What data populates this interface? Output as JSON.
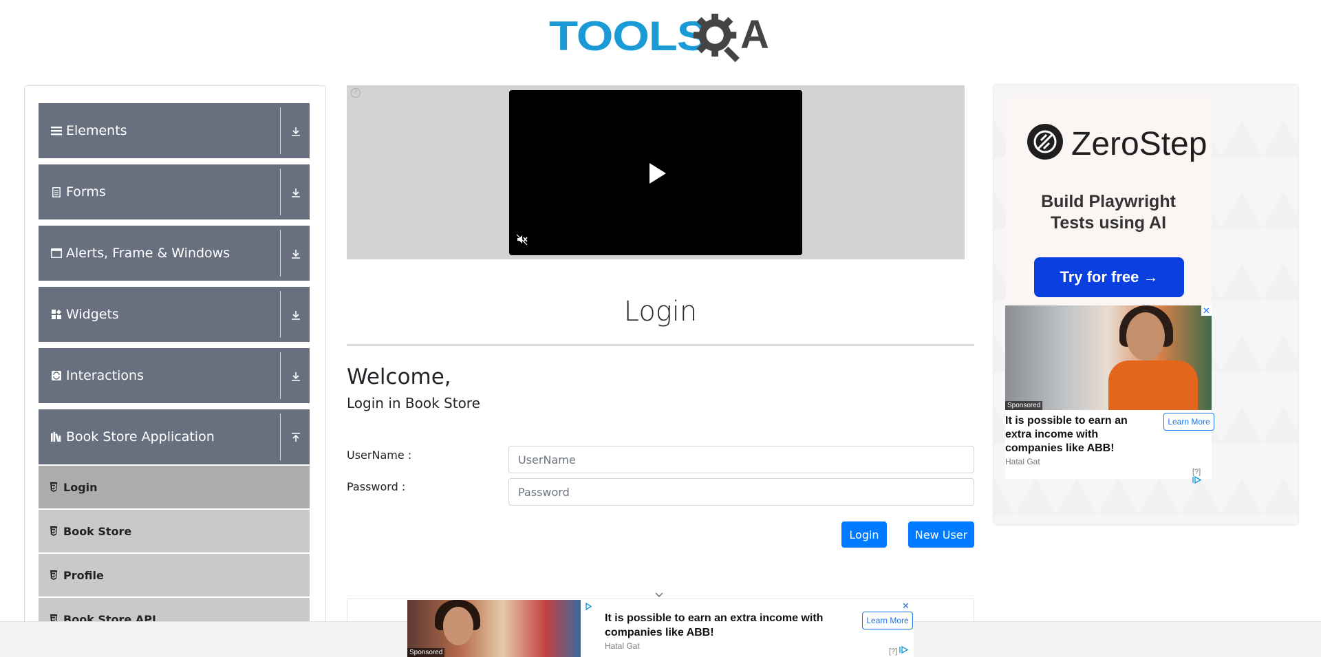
{
  "logo": {
    "text_tools": "TOOLS",
    "text_a": "A"
  },
  "sidebar": {
    "groups": [
      {
        "label": "Elements",
        "icon": "list-icon"
      },
      {
        "label": "Forms",
        "icon": "document-icon"
      },
      {
        "label": "Alerts, Frame & Windows",
        "icon": "window-icon"
      },
      {
        "label": "Widgets",
        "icon": "grid-icon"
      },
      {
        "label": "Interactions",
        "icon": "interactions-icon"
      },
      {
        "label": "Book Store Application",
        "icon": "books-icon"
      }
    ],
    "sub_items": [
      {
        "label": "Login"
      },
      {
        "label": "Book Store"
      },
      {
        "label": "Profile"
      },
      {
        "label": "Book Store API"
      }
    ]
  },
  "video_ad": {
    "help": "?"
  },
  "main": {
    "header": "Login",
    "welcome": "Welcome,",
    "subtitle": "Login in Book Store",
    "username_label": "UserName :",
    "username_placeholder": "UserName",
    "password_label": "Password :",
    "password_placeholder": "Password",
    "login_button": "Login",
    "new_user_button": "New User"
  },
  "right_ad": {
    "brand": "ZeroStep",
    "tagline_line1": "Build Playwright",
    "tagline_line2": "Tests using AI",
    "cta": "Try for free →",
    "sponsored": "Sponsored",
    "close": "✕",
    "headline": "It is possible to earn an extra income with companies like ABB!",
    "source": "Hatal Gat",
    "learn_more": "Learn More",
    "adchoices": "[?]"
  },
  "bottom_ad": {
    "sponsored": "Sponsored",
    "close": "✕",
    "headline": "It is possible to earn an extra income with companies like ABB!",
    "source": "Hatal Gat",
    "learn_more": "Learn More",
    "adchoices": "[?]"
  },
  "colors": {
    "group_bg": "#687080",
    "sub_bg": "#c9c9c9",
    "sub_active_bg": "#acacac",
    "primary_button": "#007bff",
    "logo_blue": "#1a9ad6"
  }
}
